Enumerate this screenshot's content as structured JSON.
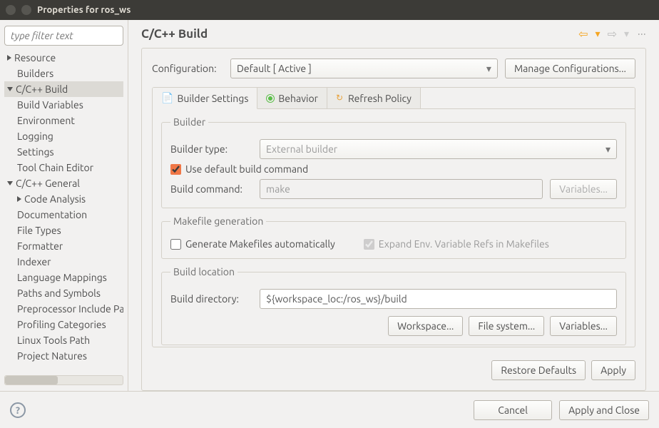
{
  "window": {
    "title": "Properties for ros_ws"
  },
  "sidebar": {
    "filter_placeholder": "type filter text",
    "items": [
      {
        "label": "Resource",
        "depth": 0,
        "arrow": "right"
      },
      {
        "label": "Builders",
        "depth": 1
      },
      {
        "label": "C/C++ Build",
        "depth": 0,
        "arrow": "down",
        "selected": true
      },
      {
        "label": "Build Variables",
        "depth": 1
      },
      {
        "label": "Environment",
        "depth": 1
      },
      {
        "label": "Logging",
        "depth": 1
      },
      {
        "label": "Settings",
        "depth": 1
      },
      {
        "label": "Tool Chain Editor",
        "depth": 1
      },
      {
        "label": "C/C++ General",
        "depth": 0,
        "arrow": "down"
      },
      {
        "label": "Code Analysis",
        "depth": 1,
        "arrow": "right"
      },
      {
        "label": "Documentation",
        "depth": 1
      },
      {
        "label": "File Types",
        "depth": 1
      },
      {
        "label": "Formatter",
        "depth": 1
      },
      {
        "label": "Indexer",
        "depth": 1
      },
      {
        "label": "Language Mappings",
        "depth": 1
      },
      {
        "label": "Paths and Symbols",
        "depth": 1
      },
      {
        "label": "Preprocessor Include Paths, Macros etc.",
        "depth": 1
      },
      {
        "label": "Profiling Categories",
        "depth": 1
      },
      {
        "label": "Linux Tools Path",
        "depth": 1
      },
      {
        "label": "Project Natures",
        "depth": 1
      }
    ]
  },
  "main": {
    "heading": "C/C++ Build",
    "config_label": "Configuration:",
    "config_value": "Default  [ Active ]",
    "manage_btn": "Manage Configurations...",
    "tabs": [
      {
        "label": "Builder Settings"
      },
      {
        "label": "Behavior"
      },
      {
        "label": "Refresh Policy"
      }
    ],
    "builder": {
      "legend": "Builder",
      "type_label": "Builder type:",
      "type_value": "External builder",
      "use_default_label": "Use default build command",
      "cmd_label": "Build command:",
      "cmd_value": "make",
      "variables_btn": "Variables..."
    },
    "makefile": {
      "legend": "Makefile generation",
      "generate_label": "Generate Makefiles automatically",
      "expand_label": "Expand Env. Variable Refs in Makefiles"
    },
    "location": {
      "legend": "Build location",
      "dir_label": "Build directory:",
      "dir_value": "${workspace_loc:/ros_ws}/build",
      "workspace_btn": "Workspace...",
      "filesystem_btn": "File system...",
      "variables_btn": "Variables..."
    },
    "restore_btn": "Restore Defaults",
    "apply_btn": "Apply"
  },
  "footer": {
    "cancel": "Cancel",
    "apply_close": "Apply and Close"
  }
}
